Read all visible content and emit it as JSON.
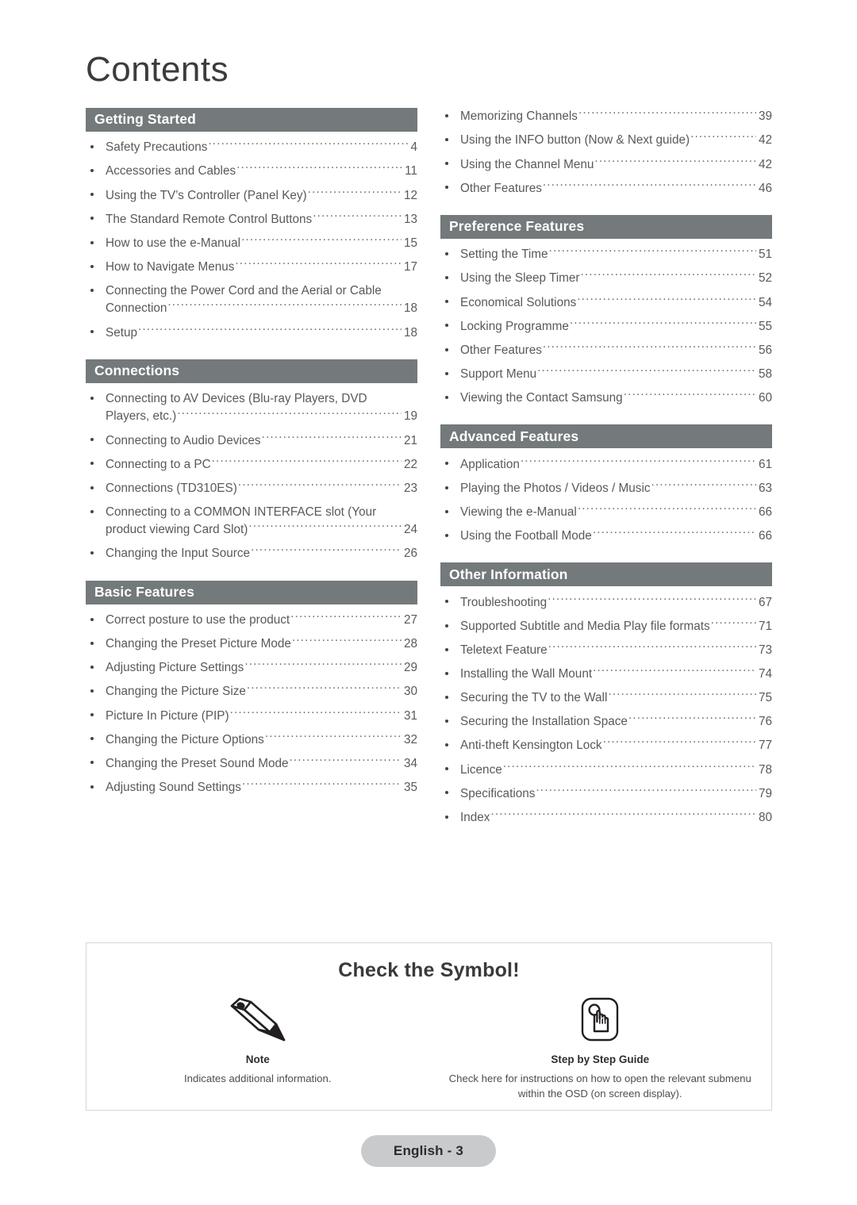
{
  "page": {
    "title": "Contents",
    "footer_label": "English - 3",
    "accent_bar_color": "#74797b",
    "footer_pill_color": "#c9cacb"
  },
  "left_column": [
    {
      "section": "Getting Started",
      "entries": [
        {
          "label": "Safety Precautions",
          "page": "4"
        },
        {
          "label": "Accessories and Cables",
          "page": "11"
        },
        {
          "label": "Using the TV’s Controller (Panel Key)",
          "page": "12"
        },
        {
          "label": "The Standard Remote Control Buttons",
          "page": "13"
        },
        {
          "label": "How to use the e-Manual",
          "page": "15"
        },
        {
          "label": "How to Navigate Menus",
          "page": "17"
        },
        {
          "label": "Connecting the Power Cord and the Aerial or Cable",
          "label2": "Connection",
          "page": "18"
        },
        {
          "label": "Setup",
          "page": "18"
        }
      ]
    },
    {
      "section": "Connections",
      "entries": [
        {
          "label": "Connecting to AV Devices (Blu-ray Players, DVD",
          "label2": "Players, etc.)",
          "page": "19"
        },
        {
          "label": "Connecting to Audio Devices",
          "page": "21"
        },
        {
          "label": "Connecting to a PC",
          "page": "22"
        },
        {
          "label": "Connections (TD310ES)",
          "page": "23"
        },
        {
          "label": "Connecting to a COMMON INTERFACE slot (Your",
          "label2": "product viewing Card Slot)",
          "page": "24"
        },
        {
          "label": "Changing the Input Source",
          "page": "26"
        }
      ]
    },
    {
      "section": "Basic Features",
      "entries": [
        {
          "label": "Correct posture to use the product",
          "page": "27"
        },
        {
          "label": "Changing the Preset Picture Mode",
          "page": "28"
        },
        {
          "label": "Adjusting Picture Settings",
          "page": "29"
        },
        {
          "label": "Changing the Picture Size",
          "page": "30"
        },
        {
          "label": "Picture In Picture (PIP)",
          "page": "31"
        },
        {
          "label": "Changing the Picture Options",
          "page": "32"
        },
        {
          "label": "Changing the Preset Sound Mode",
          "page": "34"
        },
        {
          "label": "Adjusting Sound Settings",
          "page": "35"
        }
      ]
    }
  ],
  "right_column": [
    {
      "section": null,
      "entries": [
        {
          "label": "Memorizing Channels",
          "page": "39"
        },
        {
          "label": "Using the INFO button (Now & Next guide)",
          "page": "42"
        },
        {
          "label": "Using the Channel Menu",
          "page": "42"
        },
        {
          "label": "Other Features",
          "page": "46"
        }
      ]
    },
    {
      "section": "Preference Features",
      "entries": [
        {
          "label": "Setting the Time",
          "page": "51"
        },
        {
          "label": "Using the Sleep Timer",
          "page": "52"
        },
        {
          "label": "Economical Solutions",
          "page": "54"
        },
        {
          "label": "Locking Programme",
          "page": "55"
        },
        {
          "label": "Other Features",
          "page": "56"
        },
        {
          "label": "Support Menu",
          "page": "58"
        },
        {
          "label": "Viewing the Contact Samsung",
          "page": "60"
        }
      ]
    },
    {
      "section": "Advanced Features",
      "entries": [
        {
          "label": "Application",
          "page": "61"
        },
        {
          "label": "Playing the Photos / Videos / Music",
          "page": "63"
        },
        {
          "label": "Viewing the e-Manual",
          "page": "66"
        },
        {
          "label": "Using the Football Mode",
          "page": "66"
        }
      ]
    },
    {
      "section": "Other Information",
      "entries": [
        {
          "label": "Troubleshooting",
          "page": "67"
        },
        {
          "label": "Supported Subtitle and Media Play file formats",
          "page": "71"
        },
        {
          "label": "Teletext Feature",
          "page": "73"
        },
        {
          "label": "Installing the Wall Mount",
          "page": "74"
        },
        {
          "label": "Securing the TV to the Wall",
          "page": "75"
        },
        {
          "label": "Securing the Installation Space",
          "page": "76"
        },
        {
          "label": "Anti-theft Kensington Lock",
          "page": "77"
        },
        {
          "label": "Licence",
          "page": "78"
        },
        {
          "label": "Specifications",
          "page": "79"
        },
        {
          "label": "Index",
          "page": "80"
        }
      ]
    }
  ],
  "symbol_box": {
    "heading": "Check the Symbol!",
    "items": [
      {
        "icon": "pencil-icon",
        "name": "Note",
        "description": "Indicates additional information."
      },
      {
        "icon": "hand-press-button-icon",
        "name": "Step by Step Guide",
        "description": "Check here for instructions on how to open the relevant submenu within the OSD (on screen display)."
      }
    ]
  }
}
